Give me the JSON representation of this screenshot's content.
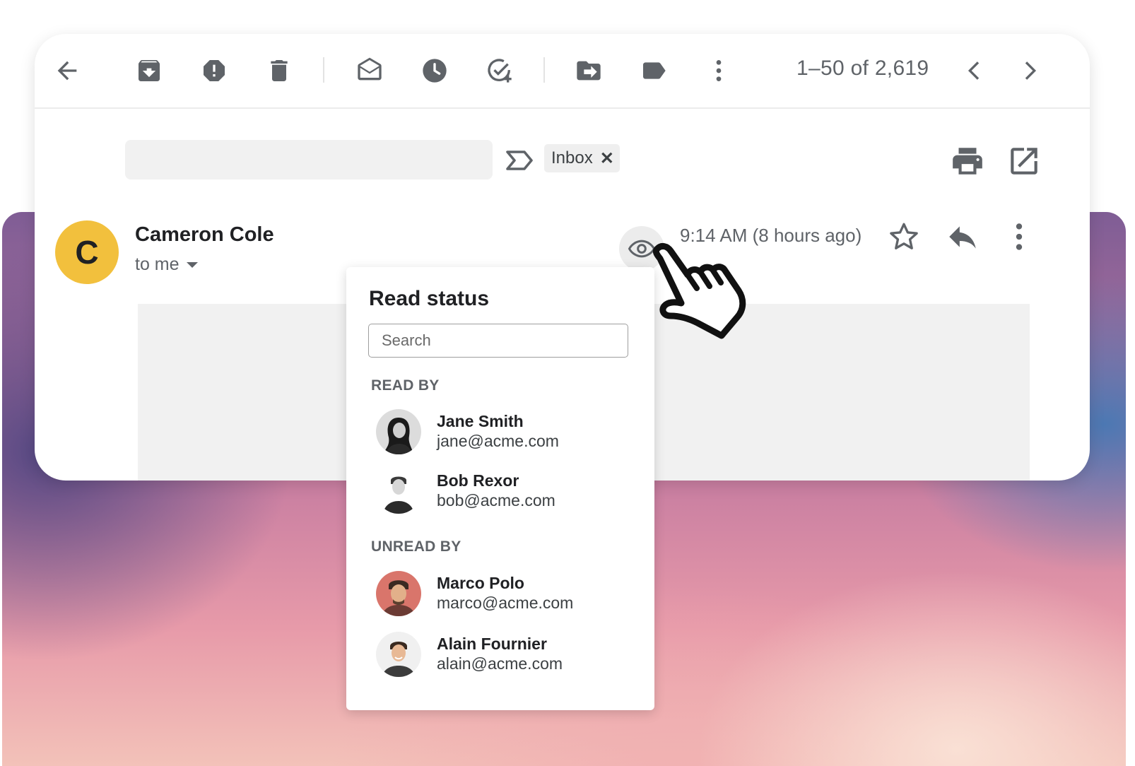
{
  "toolbar": {
    "icons": [
      "back-arrow-icon",
      "archive-icon",
      "report-spam-icon",
      "delete-icon",
      "mark-unread-icon",
      "snooze-icon",
      "add-task-icon",
      "move-to-icon",
      "label-icon",
      "more-vert-icon"
    ],
    "count_text": "1–50 of 2,619"
  },
  "subject": {
    "label_chip": "Inbox",
    "chip_close": "✕"
  },
  "message": {
    "avatar_initial": "C",
    "avatar_color": "#f2c03d",
    "sender_name": "Cameron Cole",
    "recipient_text": "to me",
    "time_text": "9:14 AM (8 hours ago)"
  },
  "read_status": {
    "title": "Read status",
    "search_placeholder": "Search",
    "read_heading": "READ BY",
    "unread_heading": "UNREAD BY",
    "read_by": [
      {
        "name": "Jane Smith",
        "email": "jane@acme.com"
      },
      {
        "name": "Bob Rexor",
        "email": "bob@acme.com"
      }
    ],
    "unread_by": [
      {
        "name": "Marco Polo",
        "email": "marco@acme.com"
      },
      {
        "name": "Alain Fournier",
        "email": "alain@acme.com"
      }
    ]
  }
}
